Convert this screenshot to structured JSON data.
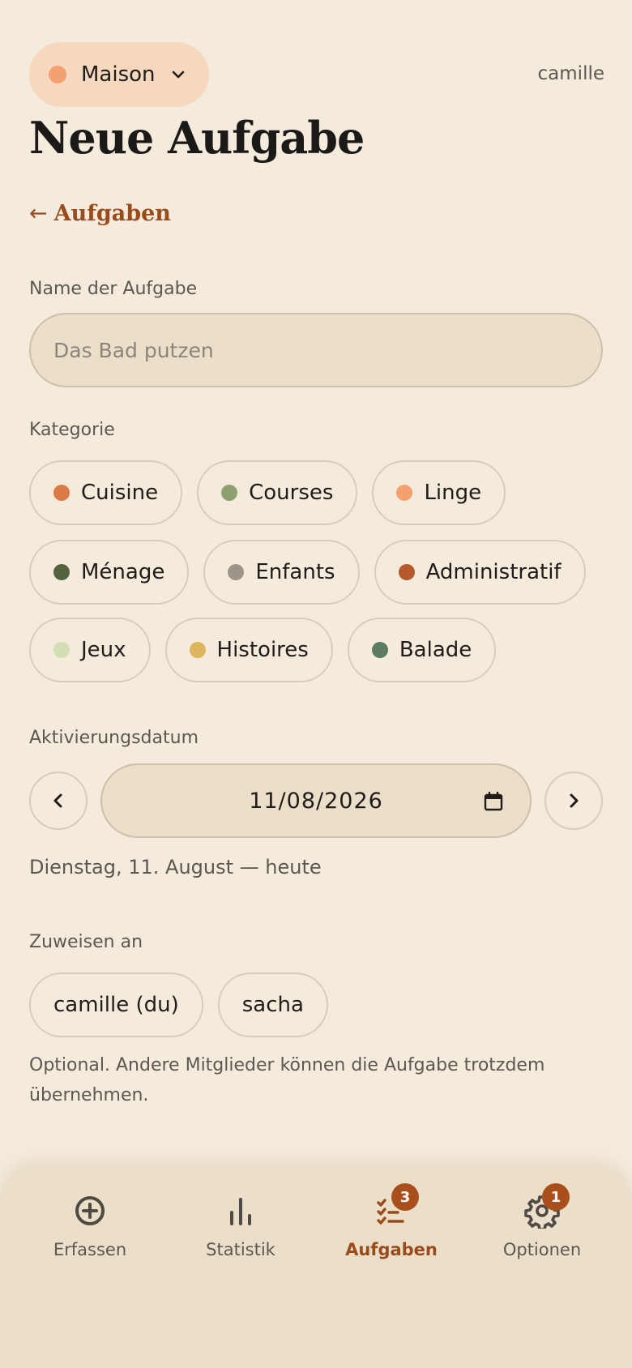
{
  "header": {
    "household": {
      "name": "Maison",
      "color": "#f4a06f"
    },
    "username": "camille",
    "title": "Neue Aufgabe",
    "back_arrow": "←",
    "back_label": "Aufgaben"
  },
  "form": {
    "name_label": "Name der Aufgabe",
    "name_placeholder": "Das Bad putzen",
    "name_value": "",
    "category_label": "Kategorie",
    "categories": [
      {
        "label": "Cuisine",
        "color": "#d97b46"
      },
      {
        "label": "Courses",
        "color": "#8fa070"
      },
      {
        "label": "Linge",
        "color": "#f4a06f"
      },
      {
        "label": "Ménage",
        "color": "#556240"
      },
      {
        "label": "Enfants",
        "color": "#9e958a"
      },
      {
        "label": "Administratif",
        "color": "#b5592a"
      },
      {
        "label": "Jeux",
        "color": "#d2dfb5"
      },
      {
        "label": "Histoires",
        "color": "#dcb65e"
      },
      {
        "label": "Balade",
        "color": "#5b7c63"
      }
    ],
    "date_label": "Aktivierungsdatum",
    "date_value": "11/08/2026",
    "date_caption": "Dienstag, 11. August — heute",
    "assign_label": "Zuweisen an",
    "assignees": [
      {
        "label": "camille (du)"
      },
      {
        "label": "sacha"
      }
    ],
    "assign_helper": "Optional. Andere Mitglieder können die Aufgabe trotzdem übernehmen."
  },
  "nav": {
    "items": [
      {
        "label": "Erfassen",
        "icon": "plus-circle-icon",
        "active": false
      },
      {
        "label": "Statistik",
        "icon": "bar-chart-icon",
        "active": false
      },
      {
        "label": "Aufgaben",
        "icon": "task-list-icon",
        "active": true,
        "badge": "3"
      },
      {
        "label": "Optionen",
        "icon": "gear-icon",
        "active": false,
        "badge": "1"
      }
    ],
    "active_color": "#9a4b1c"
  }
}
